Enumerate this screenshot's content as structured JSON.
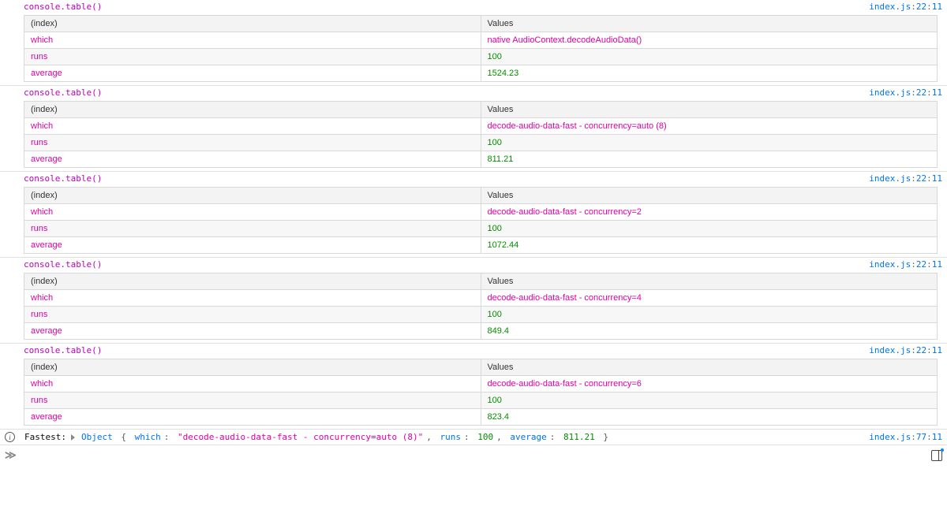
{
  "source": {
    "file": "index.js",
    "tableLine": "22",
    "tableCol": "11",
    "logLine": "77",
    "logCol": "11"
  },
  "call": "console.table()",
  "headers": {
    "index": "(index)",
    "values": "Values"
  },
  "rowKeys": {
    "which": "which",
    "runs": "runs",
    "average": "average"
  },
  "tables": [
    {
      "which": "native AudioContext.decodeAudioData()",
      "runs": "100",
      "average": "1524.23"
    },
    {
      "which": "decode-audio-data-fast - concurrency=auto (8)",
      "runs": "100",
      "average": "811.21"
    },
    {
      "which": "decode-audio-data-fast - concurrency=2",
      "runs": "100",
      "average": "1072.44"
    },
    {
      "which": "decode-audio-data-fast - concurrency=4",
      "runs": "100",
      "average": "849.4"
    },
    {
      "which": "decode-audio-data-fast - concurrency=6",
      "runs": "100",
      "average": "823.4"
    }
  ],
  "fastest": {
    "label": "Fastest:",
    "objWord": "Object",
    "which": "\"decode-audio-data-fast - concurrency=auto (8)\"",
    "runs": "100",
    "average": "811.21"
  }
}
